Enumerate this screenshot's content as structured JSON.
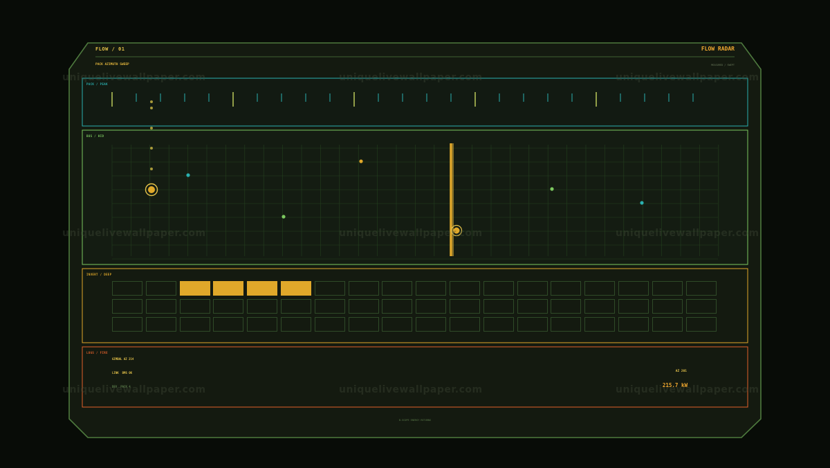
{
  "header": {
    "title": "FLOW / 01",
    "app_name": "FLOW RADAR",
    "subtitle": "PACK AZIMUTH SWEEP",
    "meta": "MEASURED / SWEPT"
  },
  "panels": {
    "peak": {
      "label": "PACK / PEAK",
      "color": "#2ab0b0"
    },
    "bus": {
      "label": "BUS / HID",
      "color": "#7cc860"
    },
    "inverter": {
      "label": "INVERT / DEEP",
      "color": "#e0a82a"
    },
    "logs": {
      "label": "LOGS / FIRE",
      "color": "#e0602a"
    }
  },
  "inverter_grid": {
    "rows": 3,
    "cols": 18,
    "active": [
      [
        0,
        2
      ],
      [
        0,
        3
      ],
      [
        0,
        4
      ],
      [
        0,
        5
      ]
    ]
  },
  "logs": {
    "line1": "GIMBAL  AZ 214",
    "line2_key": "LINK",
    "line2_val": "BMS OK",
    "line3_key": "DEV",
    "line3_val": "PACK 4",
    "az": "AZ 201",
    "power": "215.7 kW"
  },
  "footer": "B-SCOPE  ENERGY RETURNS",
  "watermark": "uniquelivewallpaper.com",
  "colors": {
    "accent_yellow": "#e0a82a",
    "accent_green": "#7cc860",
    "accent_teal": "#2ab0b0",
    "accent_orange": "#e0602a",
    "frame": "#4e7a3e"
  }
}
